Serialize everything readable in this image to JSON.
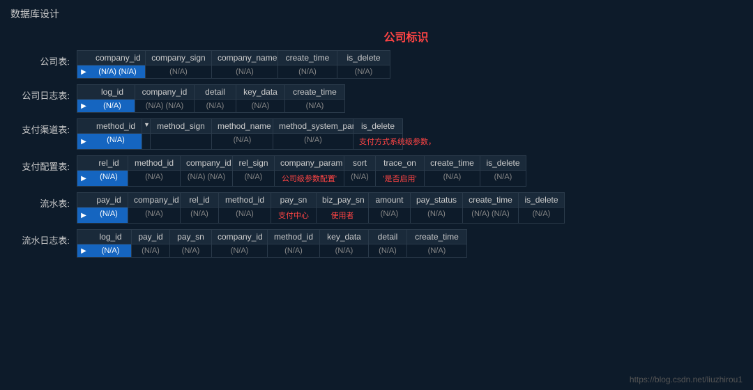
{
  "page": {
    "title": "数据库设计",
    "section_title": "公司标识",
    "watermark": "https://blog.csdn.net/liuzhirou1"
  },
  "sections": [
    {
      "id": "company-table",
      "label": "公司表:",
      "headers": [
        "company_id",
        "company_sign",
        "company_name",
        "create_time",
        "is_delete"
      ],
      "widths": [
        80,
        95,
        95,
        85,
        75
      ],
      "rows": [
        {
          "arrow": "▶",
          "cells": [
            "(N/A) (N/A)",
            "(N/A)",
            "(N/A)",
            "(N/A)",
            "(N/A)"
          ],
          "highlighted": [
            0
          ]
        }
      ]
    },
    {
      "id": "company-log-table",
      "label": "公司日志表:",
      "headers": [
        "log_id",
        "company_id",
        "detail",
        "key_data",
        "create_time"
      ],
      "widths": [
        65,
        85,
        60,
        70,
        85
      ],
      "rows": [
        {
          "arrow": "▶",
          "cells": [
            "(N/A)",
            "(N/A) (N/A)",
            "(N/A)",
            "(N/A)",
            "(N/A)"
          ],
          "highlighted": [
            0
          ]
        }
      ]
    },
    {
      "id": "pay-method-table",
      "label": "支付渠道表:",
      "headers": [
        "method_id",
        "▼",
        "method_sign",
        "method_name",
        "method_system_param",
        "is_delete"
      ],
      "widths": [
        75,
        12,
        88,
        88,
        115,
        70
      ],
      "rows": [
        {
          "arrow": "▶",
          "cells": [
            "(N/A)",
            "",
            "(N/A)",
            "(N/A)",
            "支付方式系统级参数，",
            "(N/A)"
          ],
          "highlighted": [
            0
          ],
          "red": [
            4
          ]
        }
      ]
    },
    {
      "id": "pay-config-table",
      "label": "支付配置表:",
      "headers": [
        "rel_id",
        "method_id",
        "company_id",
        "rel_sign",
        "company_param",
        "sort",
        "trace_on",
        "create_time",
        "is_delete"
      ],
      "widths": [
        55,
        75,
        75,
        60,
        100,
        45,
        70,
        80,
        65
      ],
      "rows": [
        {
          "arrow": "▶",
          "cells": [
            "(N/A)",
            "(N/A)",
            "(N/A) (N/A)",
            "(N/A)",
            "公司级参数配置'",
            "(N/A)",
            "'是否启用'",
            "(N/A)",
            "(N/A)"
          ],
          "highlighted": [
            0
          ],
          "red": [
            4,
            6
          ]
        }
      ]
    },
    {
      "id": "flow-table",
      "label": "流水表:",
      "headers": [
        "pay_id",
        "company_id",
        "rel_id",
        "method_id",
        "pay_sn",
        "biz_pay_sn",
        "amount",
        "pay_status",
        "create_time",
        "is_delete"
      ],
      "widths": [
        55,
        75,
        55,
        75,
        65,
        75,
        60,
        75,
        80,
        65
      ],
      "rows": [
        {
          "arrow": "▶",
          "cells": [
            "(N/A)",
            "(N/A)",
            "(N/A)",
            "(N/A)",
            "支付中心",
            "使用者",
            "(N/A)",
            "(N/A)",
            "(N/A) (N/A)",
            "(N/A)"
          ],
          "highlighted": [
            0
          ],
          "red": [
            4,
            5
          ]
        }
      ]
    },
    {
      "id": "flow-log-table",
      "label": "流水日志表:",
      "headers": [
        "log_id",
        "pay_id",
        "pay_sn",
        "company_id",
        "method_id",
        "key_data",
        "detail",
        "create_time"
      ],
      "widths": [
        60,
        55,
        60,
        80,
        75,
        70,
        55,
        85
      ],
      "rows": [
        {
          "arrow": "▶",
          "cells": [
            "(N/A)",
            "(N/A)",
            "(N/A)",
            "(N/A)",
            "(N/A)",
            "(N/A)",
            "(N/A)",
            "(N/A)"
          ],
          "highlighted": [
            0
          ]
        }
      ]
    }
  ]
}
